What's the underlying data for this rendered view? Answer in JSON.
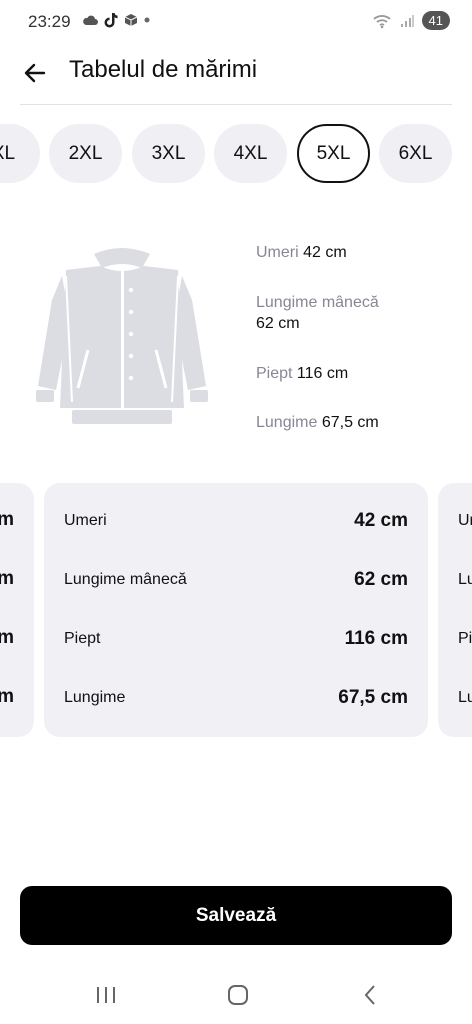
{
  "status": {
    "time": "23:29",
    "battery": "41",
    "icons": [
      "cloud-icon",
      "tiktok-icon",
      "box-icon",
      "dot-icon",
      "wifi-icon",
      "signal-icon",
      "battery-icon"
    ]
  },
  "header": {
    "title": "Tabelul de mărimi",
    "back_icon": "arrow-left-icon"
  },
  "sizes": {
    "items": [
      "XL",
      "2XL",
      "3XL",
      "4XL",
      "5XL",
      "6XL"
    ],
    "selected": "5XL"
  },
  "measures": {
    "shoulders": {
      "label": "Umeri",
      "value": "42 cm"
    },
    "sleeve": {
      "label": "Lungime mânecă",
      "value": "62 cm"
    },
    "chest": {
      "label": "Piept",
      "value": "116 cm"
    },
    "length": {
      "label": "Lungime",
      "value": "67,5 cm"
    }
  },
  "card": {
    "rows": [
      {
        "label": "Umeri",
        "value": "42 cm"
      },
      {
        "label": "Lungime mânecă",
        "value": "62 cm"
      },
      {
        "label": "Piept",
        "value": "116 cm"
      },
      {
        "label": "Lungime",
        "value": "67,5 cm"
      }
    ],
    "left_fragments": [
      "m",
      "m",
      "m",
      "m"
    ],
    "right_fragments": [
      "Ur",
      "Lu",
      "Pi",
      "Lu"
    ]
  },
  "actions": {
    "save_label": "Salvează"
  },
  "colors": {
    "accent": "#000000",
    "chip_bg": "#f0f0f4",
    "label_muted": "#8a8595"
  }
}
